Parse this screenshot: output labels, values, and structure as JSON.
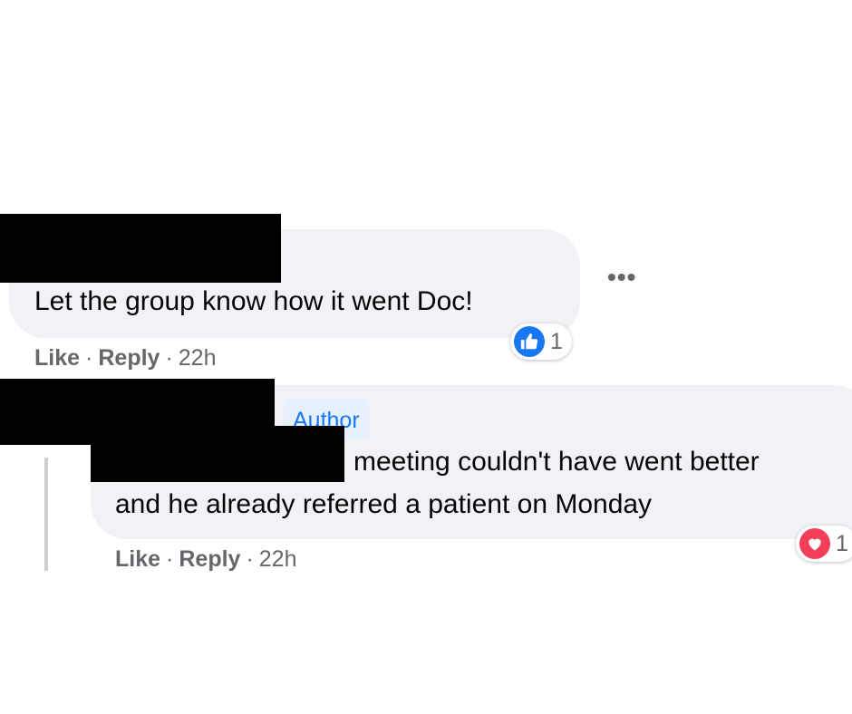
{
  "comments": [
    {
      "text": "Let the group know how it went Doc!",
      "like_label": "Like",
      "reply_label": "Reply",
      "separator": "·",
      "time": "22h",
      "reaction": {
        "type": "like",
        "count": "1",
        "color": "#1877f2"
      },
      "more_icon": "ellipsis-icon"
    },
    {
      "badge": "Author",
      "text_line1": "meeting couldn't have went better",
      "text_line2": "and he already referred a patient on Monday",
      "like_label": "Like",
      "reply_label": "Reply",
      "separator": "·",
      "time": "22h",
      "reaction": {
        "type": "love",
        "count": "1",
        "color": "#f33e58"
      }
    }
  ]
}
